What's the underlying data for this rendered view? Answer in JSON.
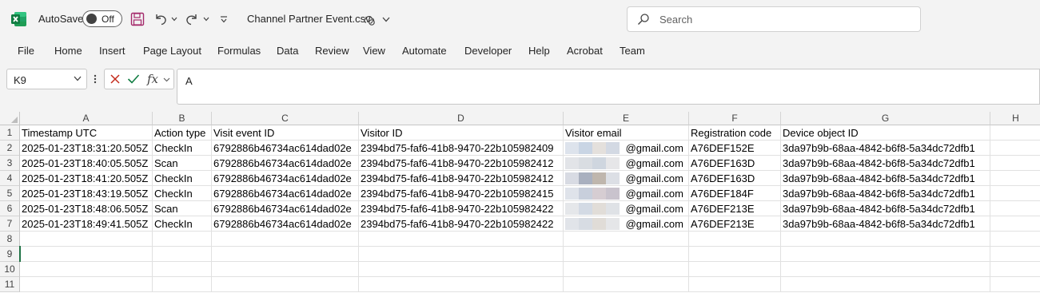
{
  "app": {
    "autosave_label": "AutoSave",
    "autosave_state": "Off",
    "doc_title": "Channel Partner Event.csv",
    "search_placeholder": "Search",
    "accent_color": "#217346"
  },
  "menu": [
    "File",
    "Home",
    "Insert",
    "Page Layout",
    "Formulas",
    "Data",
    "Review",
    "View",
    "Automate",
    "Developer",
    "Help",
    "Acrobat",
    "Team"
  ],
  "formula_bar": {
    "name_box": "K9",
    "fx_label": "fx",
    "content": "A"
  },
  "sheet": {
    "columns": [
      "A",
      "B",
      "C",
      "D",
      "E",
      "F",
      "G",
      "H"
    ],
    "row_numbers": [
      "1",
      "2",
      "3",
      "4",
      "5",
      "6",
      "7",
      "8",
      "9",
      "10",
      "11"
    ],
    "header_row": [
      "Timestamp UTC",
      "Action type",
      "Visit event ID",
      "Visitor ID",
      "Visitor email",
      "Registration code",
      "Device object ID"
    ],
    "rows": [
      [
        "2025-01-23T18:31:20.505Z",
        "CheckIn",
        "6792886b46734ac614dad02e",
        "2394bd75-faf6-41b8-9470-22b105982409",
        "@gmail.com",
        "A76DEF152E",
        "3da97b9b-68aa-4842-b6f8-5a34dc72dfb1"
      ],
      [
        "2025-01-23T18:40:05.505Z",
        "Scan",
        "6792886b46734ac614dad02e",
        "2394bd75-faf6-41b8-9470-22b105982412",
        "@gmail.com",
        "A76DEF163D",
        "3da97b9b-68aa-4842-b6f8-5a34dc72dfb1"
      ],
      [
        "2025-01-23T18:41:20.505Z",
        "CheckIn",
        "6792886b46734ac614dad02e",
        "2394bd75-faf6-41b8-9470-22b105982412",
        "@gmail.com",
        "A76DEF163D",
        "3da97b9b-68aa-4842-b6f8-5a34dc72dfb1"
      ],
      [
        "2025-01-23T18:43:19.505Z",
        "CheckIn",
        "6792886b46734ac614dad02e",
        "2394bd75-faf6-41b8-9470-22b105982415",
        "@gmail.com",
        "A76DEF184F",
        "3da97b9b-68aa-4842-b6f8-5a34dc72dfb1"
      ],
      [
        "2025-01-23T18:48:06.505Z",
        "Scan",
        "6792886b46734ac614dad02e",
        "2394bd75-faf6-41b8-9470-22b105982422",
        "@gmail.com",
        "A76DEF213E",
        "3da97b9b-68aa-4842-b6f8-5a34dc72dfb1"
      ],
      [
        "2025-01-23T18:49:41.505Z",
        "CheckIn",
        "6792886b46734ac614dad02e",
        "2394bd75-faf6-41b8-9470-22b105982422",
        "@gmail.com",
        "A76DEF213E",
        "3da97b9b-68aa-4842-b6f8-5a34dc72dfb1"
      ]
    ],
    "selected_cell": "A9"
  }
}
